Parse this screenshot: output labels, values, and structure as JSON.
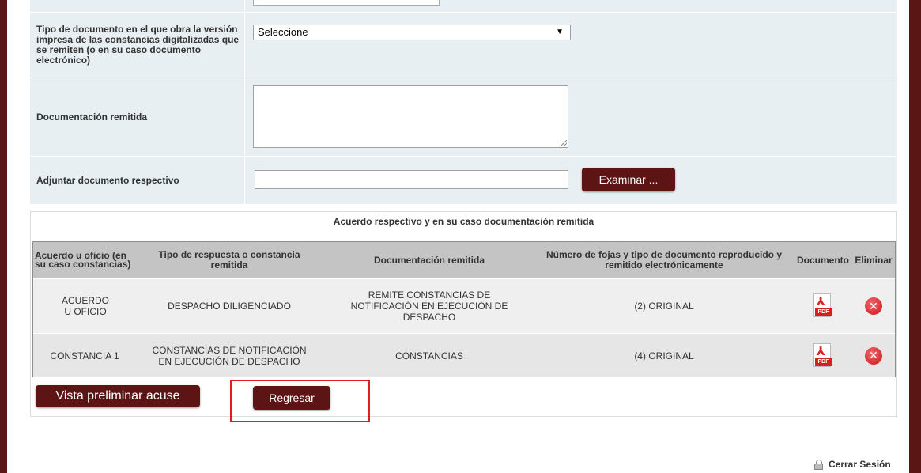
{
  "form": {
    "tipo_documento_label": "Tipo de documento en el que obra la versión impresa de las constancias digitalizadas que se remiten (o en su caso documento electrónico)",
    "tipo_documento_value": "Seleccione",
    "documentacion_label": "Documentación remitida",
    "documentacion_value": "",
    "adjuntar_label": "Adjuntar documento respectivo",
    "adjuntar_value": "",
    "examinar_label": "Examinar ..."
  },
  "table": {
    "caption": "Acuerdo respectivo y en su caso documentación remitida",
    "headers": [
      "Acuerdo u oficio (en su caso constancias)",
      "Tipo de respuesta o constancia remitida",
      "Documentación remitida",
      "Número de fojas y tipo de documento reproducido y remitido electrónicamente",
      "Documento",
      "Eliminar"
    ],
    "rows": [
      {
        "acuerdo": "ACUERDO U OFICIO",
        "tipo": "DESPACHO DILIGENCIADO",
        "documentacion": "REMITE CONSTANCIAS DE NOTIFICACIÓN EN EJECUCIÓN DE DESPACHO",
        "fojas": "(2) ORIGINAL"
      },
      {
        "acuerdo": "CONSTANCIA 1",
        "tipo": "CONSTANCIAS DE NOTIFICACIÓN EN EJECUCIÓN DE DESPACHO",
        "documentacion": "CONSTANCIAS",
        "fojas": "(4) ORIGINAL"
      }
    ],
    "pdf_tag": "PDF",
    "document_icon": "pdf-icon",
    "delete_icon": "delete-icon"
  },
  "actions": {
    "vista_label": "Vista preliminar acuse",
    "regresar_label": "Regresar"
  },
  "footer": {
    "logout_label": "Cerrar Sesión",
    "logout_icon": "lock-icon"
  },
  "colors": {
    "brand_dark_red": "#5c1414",
    "form_background": "#e8eff2",
    "highlight_red": "#e31b23",
    "delete_red": "#c8141a"
  }
}
